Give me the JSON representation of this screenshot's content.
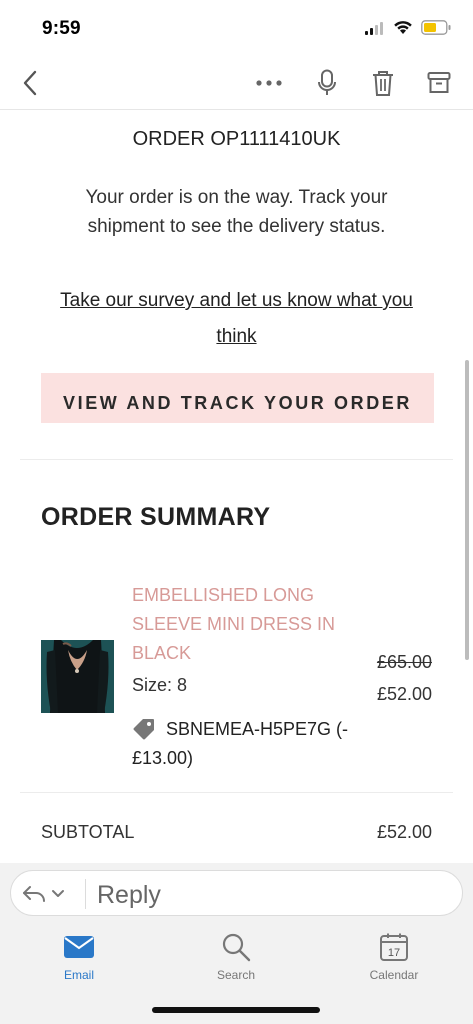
{
  "status_bar": {
    "time": "9:59"
  },
  "nav": {
    "back_icon": "chevron-left-icon",
    "icons": [
      "more-icon",
      "microphone-icon",
      "trash-icon",
      "archive-icon"
    ]
  },
  "email": {
    "order_number": "ORDER OP1111410UK",
    "intro": "Your order is on the way. Track your shipment to see the delivery status.",
    "survey_link": "Take our survey and let us know what you think",
    "track_button": "VIEW AND TRACK YOUR ORDER",
    "summary_heading": "ORDER SUMMARY",
    "product": {
      "name": "EMBELLISHED LONG SLEEVE MINI DRESS IN BLACK",
      "size": "Size: 8",
      "discount": "SBNEMEA-H5PE7G (-£13.00)",
      "price_original": "£65.00",
      "price_current": "£52.00"
    },
    "subtotal_label": "SUBTOTAL",
    "subtotal_value": "£52.00"
  },
  "reply": {
    "placeholder": "Reply"
  },
  "tabs": [
    {
      "label": "Email",
      "icon": "envelope-icon",
      "active": true
    },
    {
      "label": "Search",
      "icon": "search-icon",
      "active": false
    },
    {
      "label": "Calendar",
      "icon": "calendar-icon",
      "active": false,
      "badge": "17"
    }
  ],
  "colors": {
    "accent": "#2a78c8",
    "track_button_bg": "#fbe1e0",
    "product_name": "#d79a97"
  }
}
